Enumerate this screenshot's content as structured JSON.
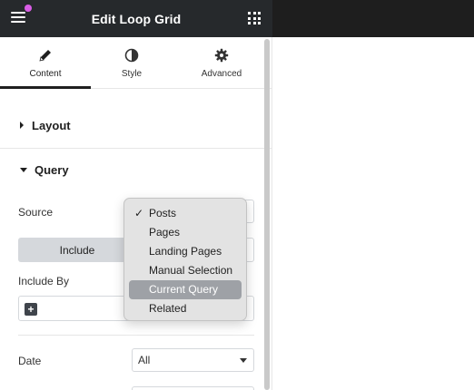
{
  "header": {
    "title": "Edit Loop Grid"
  },
  "tabs": [
    {
      "label": "Content",
      "icon": "pencil-icon",
      "active": true
    },
    {
      "label": "Style",
      "icon": "half-circle-icon",
      "active": false
    },
    {
      "label": "Advanced",
      "icon": "gear-icon",
      "active": false
    }
  ],
  "sections": {
    "layout": {
      "title": "Layout",
      "expanded": false
    },
    "query": {
      "title": "Query",
      "expanded": true
    }
  },
  "query": {
    "source_label": "Source",
    "include_tab_label": "Include",
    "include_by_label": "Include By",
    "date_label": "Date",
    "date_value": "All"
  },
  "source_dropdown": {
    "selected": "Posts",
    "highlighted": "Current Query",
    "options": [
      "Posts",
      "Pages",
      "Landing Pages",
      "Manual Selection",
      "Current Query",
      "Related"
    ]
  },
  "colors": {
    "header_bg": "#26292c",
    "notification_dot": "#d95de6",
    "highlight": "#9ea1a6"
  }
}
